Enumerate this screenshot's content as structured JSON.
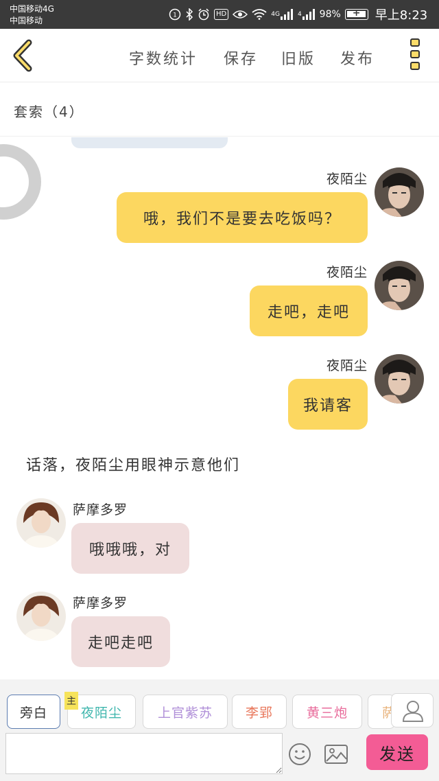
{
  "status_bar": {
    "carrier1": "中国移动4G",
    "carrier2": "中国移动",
    "signal_label_1": "4G",
    "signal_label_2": "4",
    "battery_percent": "98%",
    "time": "早上8:23"
  },
  "nav": {
    "word_count_label": "字数统计",
    "save_label": "保存",
    "old_version_label": "旧版",
    "publish_label": "发布"
  },
  "chapter": {
    "title": "套索（4）"
  },
  "messages": [
    {
      "speaker": "夜陌尘",
      "text": "哦，我们不是要去吃饭吗？",
      "side": "right"
    },
    {
      "speaker": "夜陌尘",
      "text": "走吧，走吧",
      "side": "right"
    },
    {
      "speaker": "夜陌尘",
      "text": "我请客",
      "side": "right"
    },
    {
      "narration": "话落，夜陌尘用眼神示意他们"
    },
    {
      "speaker": "萨摩多罗",
      "text": "哦哦哦，对",
      "side": "left"
    },
    {
      "speaker": "萨摩多罗",
      "text": "走吧走吧",
      "side": "left"
    }
  ],
  "composer": {
    "main_badge": "主",
    "roles": [
      {
        "label": "旁白",
        "color": "#333333"
      },
      {
        "label": "夜陌尘",
        "color": "#3fb6ad"
      },
      {
        "label": "上官紫苏",
        "color": "#b08fd8"
      },
      {
        "label": "李郢",
        "color": "#e8765a"
      },
      {
        "label": "黄三炮",
        "color": "#e86a9a"
      },
      {
        "label": "萨",
        "color": "#e8b27a"
      }
    ],
    "input_value": "",
    "send_label": "发送"
  },
  "colors": {
    "right_bubble": "#fcd760",
    "left_bubble": "#f0dddd",
    "send_button": "#f35c95"
  }
}
